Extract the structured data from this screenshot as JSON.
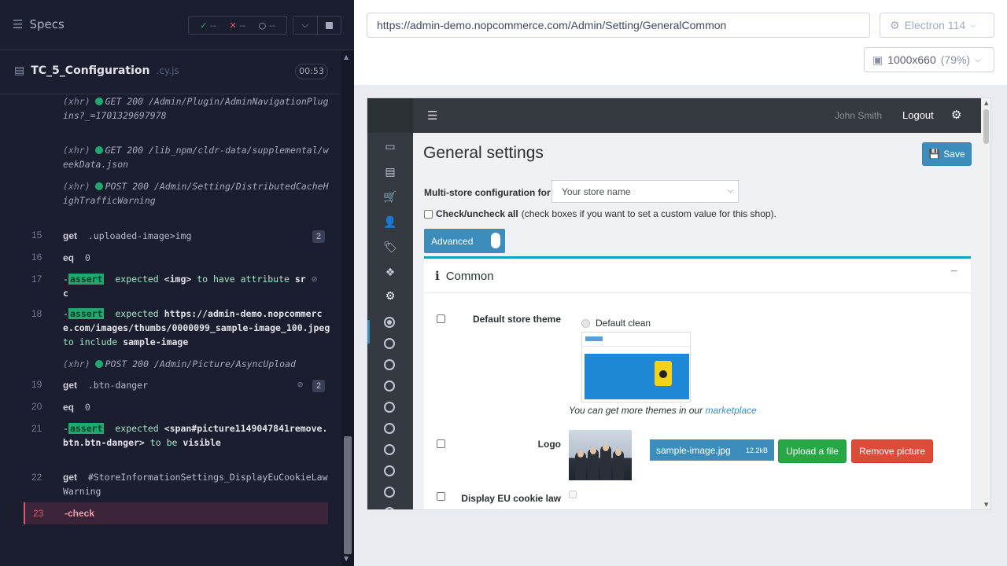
{
  "runner": {
    "specs_label": "Specs",
    "stats": {
      "passed": "--",
      "failed": "--",
      "pending": "--"
    },
    "spec_name": "TC_5_Configuration",
    "spec_ext": ".cy.js",
    "timer": "00:53"
  },
  "commands": [
    {
      "type": "xhr",
      "tag": "(xhr)",
      "text": "GET 200 /Admin/Plugin/AdminNavigationPlugins?_=1701329697978"
    },
    {
      "type": "xhr",
      "tag": "(xhr)",
      "text": "GET 200 /lib_npm/cldr-data/supplemental/weekData.json"
    },
    {
      "type": "xhr",
      "tag": "(xhr)",
      "text": "POST 200 /Admin/Setting/DistributedCacheHighTrafficWarning"
    },
    {
      "type": "cmd",
      "num": "15",
      "name": "get",
      "arg": ".uploaded-image>img",
      "badge": "2"
    },
    {
      "type": "cmd",
      "num": "16",
      "name": "eq",
      "arg": "0"
    },
    {
      "type": "assert",
      "num": "17",
      "label": "assert",
      "pre": "expected",
      "subject": "<img>",
      "mid": "to have attribute",
      "value": "src"
    },
    {
      "type": "assert",
      "num": "18",
      "label": "assert",
      "pre": "expected",
      "subject": "https://admin-demo.nopcommerce.com/images/thumbs/0000099_sample-image_100.jpeg",
      "mid": "to include",
      "value": "sample-image"
    },
    {
      "type": "xhr",
      "tag": "(xhr)",
      "text": "POST 200 /Admin/Picture/AsyncUpload"
    },
    {
      "type": "cmd",
      "num": "19",
      "name": "get",
      "arg": ".btn-danger",
      "badge": "2"
    },
    {
      "type": "cmd",
      "num": "20",
      "name": "eq",
      "arg": "0"
    },
    {
      "type": "assert",
      "num": "21",
      "label": "assert",
      "pre": "expected",
      "subject": "<span#picture1149047841remove.btn.btn-danger>",
      "mid": "to be",
      "value": "visible"
    },
    {
      "type": "cmd",
      "num": "22",
      "name": "get",
      "arg": "#StoreInformationSettings_DisplayEuCookieLawWarning"
    },
    {
      "type": "cmd",
      "num": "23",
      "name": "-check",
      "arg": ""
    }
  ],
  "aut": {
    "url": "https://admin-demo.nopcommerce.com/Admin/Setting/GeneralCommon",
    "browser": "Electron 114",
    "viewport": "1000x660",
    "viewport_pct": "(79%)"
  },
  "app": {
    "user": "John Smith",
    "logout": "Logout",
    "page_title": "General settings",
    "save": "Save",
    "multistore_label": "Multi-store configuration for",
    "multistore_value": "Your store name",
    "checkall_bold": "Check/uncheck all",
    "checkall_rest": "(check boxes if you want to set a custom value for this shop).",
    "advanced": "Advanced",
    "card_title": "Common",
    "default_theme_label": "Default store theme",
    "theme_option": "Default clean",
    "themes_note": "You can get more themes in our",
    "themes_link": "marketplace",
    "logo_label": "Logo",
    "file_name": "sample-image.jpg",
    "file_size": "12.2kB",
    "upload_btn": "Upload a file",
    "remove_btn": "Remove picture",
    "eu_cookie_label": "Display EU cookie law warning"
  }
}
